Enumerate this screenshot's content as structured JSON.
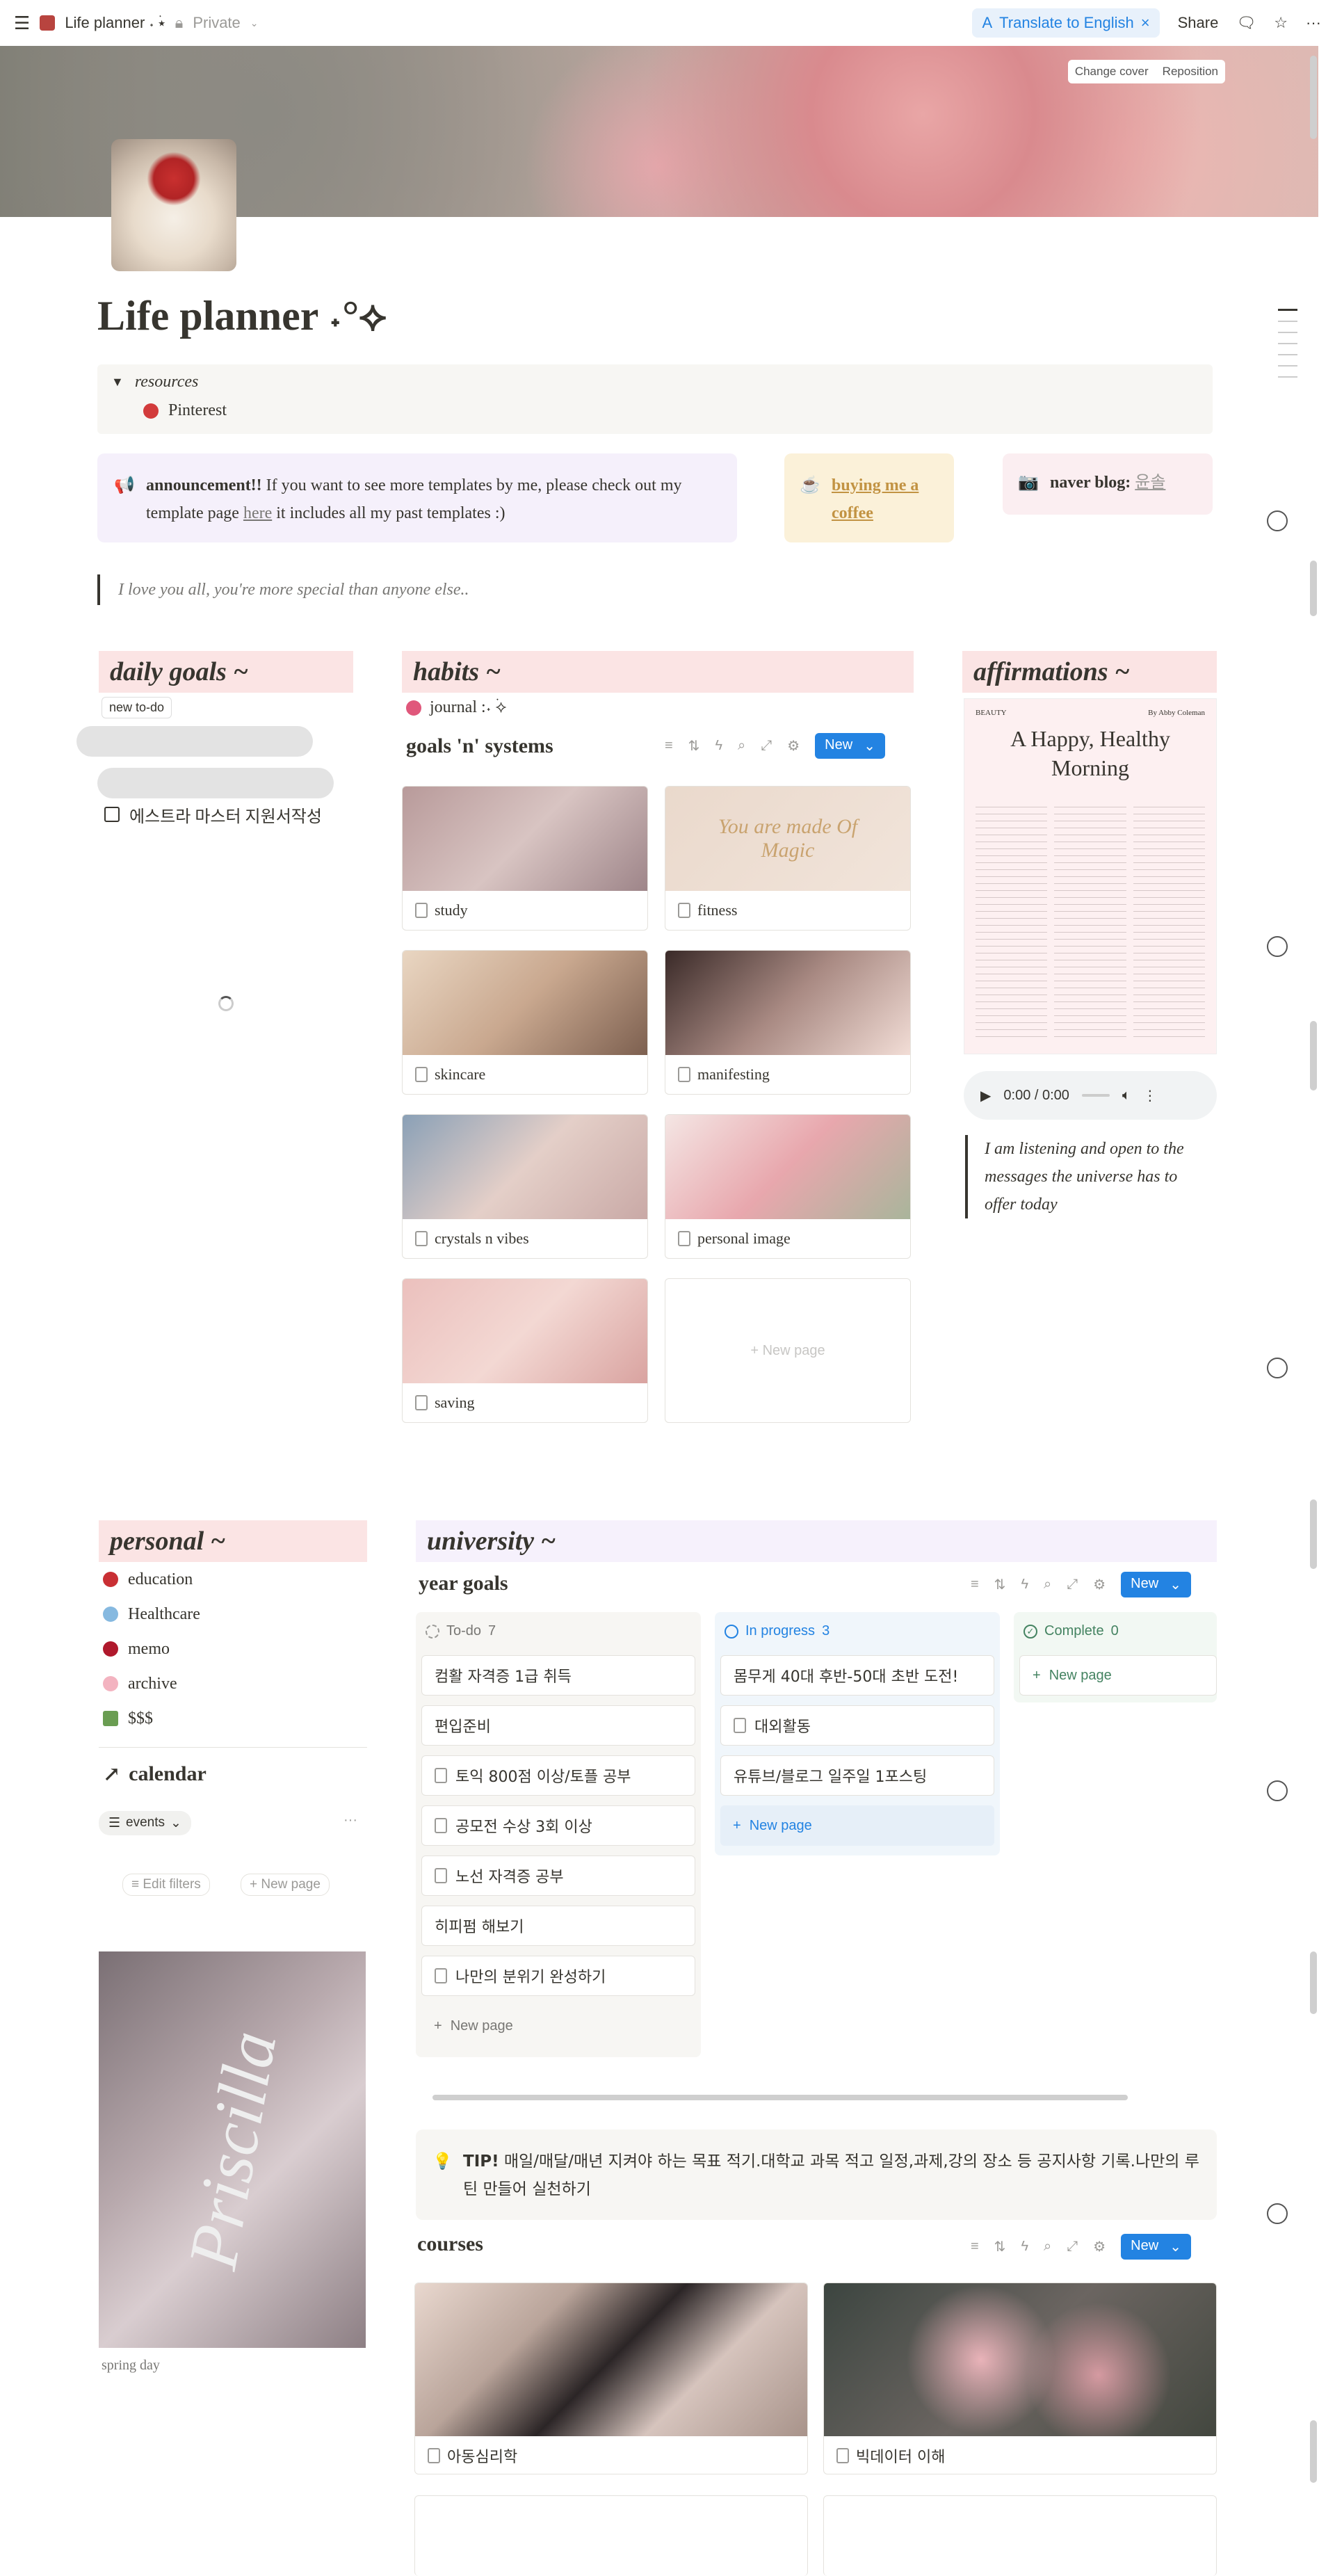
{
  "topbar": {
    "page_title": "Life planner ˖ ࣪⭑",
    "privacy": "Private",
    "translate": "Translate to English",
    "share": "Share"
  },
  "cover": {
    "change_cover": "Change cover",
    "reposition": "Reposition"
  },
  "page": {
    "title": "Life planner ˖°⟡"
  },
  "resources": {
    "label": "resources",
    "item": "Pinterest"
  },
  "announcement": {
    "bold": "announcement!!",
    "text1": " If you want to see more templates by me, please check out my template page ",
    "link": "here",
    "text2": " it includes all my past templates :)"
  },
  "coffee": {
    "label": "buying me a coffee"
  },
  "naver": {
    "bold": "naver blog:",
    "link": "윤솔"
  },
  "quote": "I love you all, you're more special than anyone else..",
  "daily": {
    "heading": "daily goals ~",
    "new_todo": "new to-do",
    "todos": [
      "",
      "",
      "에스트라 마스터 지원서작성"
    ]
  },
  "habits": {
    "heading": "habits ~",
    "journal": "journal :˖ ࣪⟡",
    "db_title": "goals 'n' systems",
    "new": "New",
    "cards": [
      "study",
      "fitness",
      "skincare",
      "manifesting",
      "crystals n vibes",
      "personal image",
      "saving"
    ],
    "new_page": "+ New page",
    "fitness_text": "You are made Of Magic"
  },
  "affirmations": {
    "heading": "affirmations ~",
    "mag_beauty": "BEAUTY",
    "mag_by": "By Abby Coleman",
    "mag_title": "A Happy, Healthy Morning",
    "audio_time": "0:00 / 0:00",
    "text": "I am listening and open to the messages the universe has to offer today"
  },
  "personal": {
    "heading": "personal ~",
    "items": [
      "education",
      "Healthcare",
      "memo",
      "archive",
      "$$$"
    ]
  },
  "calendar": {
    "heading": "calendar",
    "view": "events",
    "edit_filters": "Edit filters",
    "new_page": "New page",
    "poster_caption": "spring day",
    "poster_text": "Priscilla"
  },
  "university": {
    "heading": "university ~",
    "db_title": "year goals",
    "new": "New",
    "columns": [
      {
        "name": "To-do",
        "count": "7",
        "items": [
          "컴활 자격증 1급 취득",
          "편입준비",
          "토익 800점 이상/토플 공부",
          "공모전 수상 3회 이상",
          "노선 자격증 공부",
          "히피펌 해보기",
          "나만의 분위기 완성하기"
        ]
      },
      {
        "name": "In progress",
        "count": "3",
        "items": [
          "몸무게 40대 후반-50대 초반 도전!",
          "대외활동",
          "유튜브/블로그 일주일 1포스팅"
        ]
      },
      {
        "name": "Complete",
        "count": "0",
        "items": []
      }
    ],
    "new_page": "New page",
    "tip_bold": "TIP!",
    "tip_text": " 매일/매달/매년 지켜야 하는 목표 적기.대학교 과목 적고 일정,과제,강의 장소 등 공지사항 기록.나만의 루틴 만들어 실천하기",
    "courses_title": "courses",
    "courses": [
      "아동심리학",
      "빅데이터 이해"
    ]
  },
  "colors": {
    "accent": "#2383e2",
    "pink_head": "#fbe4e4",
    "purple_head": "#f6f1fc",
    "announce_bg": "#f5f0fb",
    "coffee_bg": "#fbf1d9",
    "naver_bg": "#fbeef1"
  }
}
